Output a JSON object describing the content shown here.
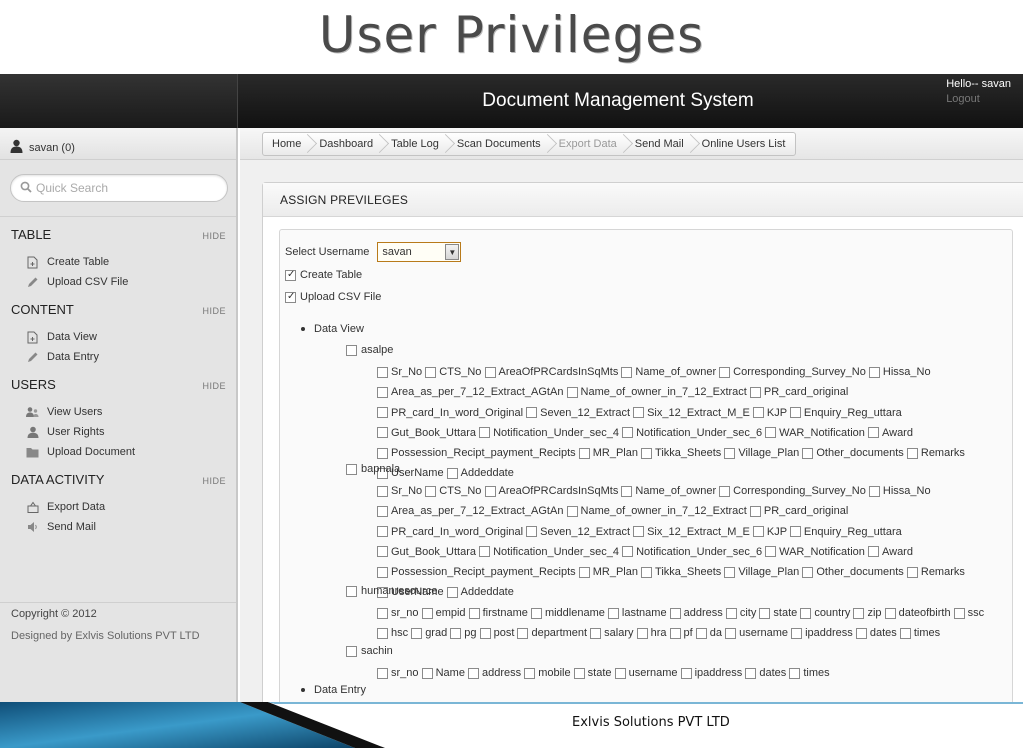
{
  "slide_title": "User Privileges",
  "app": {
    "title": "Document Management System",
    "greeting": "Hello-- savan",
    "logout": "Logout"
  },
  "user": {
    "label": "savan (0)"
  },
  "search": {
    "placeholder": "Quick Search"
  },
  "sidebar": {
    "hide_label": "HIDE",
    "sections": [
      {
        "name": "TABLE",
        "items": [
          {
            "label": "Create Table",
            "icon": "document-add-icon"
          },
          {
            "label": "Upload CSV File",
            "icon": "pencil-icon"
          }
        ]
      },
      {
        "name": "CONTENT",
        "items": [
          {
            "label": "Data View",
            "icon": "document-add-icon"
          },
          {
            "label": "Data Entry",
            "icon": "pencil-icon"
          }
        ]
      },
      {
        "name": "USERS",
        "items": [
          {
            "label": "View Users",
            "icon": "users-icon"
          },
          {
            "label": "User Rights",
            "icon": "user-icon"
          },
          {
            "label": "Upload Document",
            "icon": "folder-icon"
          }
        ]
      },
      {
        "name": "DATA ACTIVITY",
        "items": [
          {
            "label": "Export Data",
            "icon": "export-icon"
          },
          {
            "label": "Send Mail",
            "icon": "speaker-icon"
          }
        ]
      }
    ],
    "copyright": "Copyright © 2012",
    "designed_by": "Designed by Exlvis Solutions PVT LTD"
  },
  "breadcrumb": [
    {
      "label": "Home",
      "dim": false
    },
    {
      "label": "Dashboard",
      "dim": false
    },
    {
      "label": "Table Log",
      "dim": false
    },
    {
      "label": "Scan Documents",
      "dim": false
    },
    {
      "label": "Export Data",
      "dim": true
    },
    {
      "label": "Send Mail",
      "dim": false
    },
    {
      "label": "Online Users List",
      "dim": false
    }
  ],
  "panel": {
    "title": "ASSIGN PREVILEGES"
  },
  "form": {
    "select_label": "Select Username",
    "selected_user": "savan",
    "create_table": {
      "label": "Create Table",
      "checked": true
    },
    "upload_csv": {
      "label": "Upload CSV File",
      "checked": true
    },
    "data_view_label": "Data View",
    "data_entry_label": "Data Entry",
    "tables": [
      {
        "name": "asalpe",
        "columns": [
          "Sr_No",
          "CTS_No",
          "AreaOfPRCardsInSqMts",
          "Name_of_owner",
          "Corresponding_Survey_No",
          "Hissa_No",
          "Area_as_per_7_12_Extract_AGtAn",
          "Name_of_owner_in_7_12_Extract",
          "PR_card_original",
          "PR_card_In_word_Original",
          "Seven_12_Extract",
          "Six_12_Extract_M_E",
          "KJP",
          "Enquiry_Reg_uttara",
          "Gut_Book_Uttara",
          "Notification_Under_sec_4",
          "Notification_Under_sec_6",
          "WAR_Notification",
          "Award",
          "Possession_Recipt_payment_Recipts",
          "MR_Plan",
          "Tikka_Sheets",
          "Village_Plan",
          "Other_documents",
          "Remarks",
          "UserName",
          "Addeddate"
        ]
      },
      {
        "name": "bapnala",
        "columns": [
          "Sr_No",
          "CTS_No",
          "AreaOfPRCardsInSqMts",
          "Name_of_owner",
          "Corresponding_Survey_No",
          "Hissa_No",
          "Area_as_per_7_12_Extract_AGtAn",
          "Name_of_owner_in_7_12_Extract",
          "PR_card_original",
          "PR_card_In_word_Original",
          "Seven_12_Extract",
          "Six_12_Extract_M_E",
          "KJP",
          "Enquiry_Reg_uttara",
          "Gut_Book_Uttara",
          "Notification_Under_sec_4",
          "Notification_Under_sec_6",
          "WAR_Notification",
          "Award",
          "Possession_Recipt_payment_Recipts",
          "MR_Plan",
          "Tikka_Sheets",
          "Village_Plan",
          "Other_documents",
          "Remarks",
          "UserName",
          "Addeddate"
        ]
      },
      {
        "name": "humanresource",
        "columns": [
          "sr_no",
          "empid",
          "firstname",
          "middlename",
          "lastname",
          "address",
          "city",
          "state",
          "country",
          "zip",
          "dateofbirth",
          "ssc",
          "hsc",
          "grad",
          "pg",
          "post",
          "department",
          "salary",
          "hra",
          "pf",
          "da",
          "username",
          "ipaddress",
          "dates",
          "times"
        ]
      },
      {
        "name": "sachin",
        "columns": [
          "sr_no",
          "Name",
          "address",
          "mobile",
          "state",
          "username",
          "ipaddress",
          "dates",
          "times"
        ]
      }
    ]
  },
  "footer_text": "Exlvis Solutions PVT LTD",
  "colors": {
    "header_dark": "#1a1a1a",
    "sidebar_bg": "#e4e4e4",
    "select_border": "#b87a1a",
    "ribbon_blue": "#1f6f9a"
  }
}
